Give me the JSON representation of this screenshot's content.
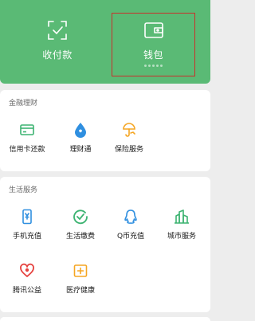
{
  "header": {
    "pay": {
      "label": "收付款",
      "icon": "qr-scan-check-icon"
    },
    "wallet": {
      "label": "钱包",
      "icon": "wallet-icon"
    }
  },
  "finance": {
    "title": "金融理财",
    "items": [
      {
        "label": "信用卡还款",
        "icon": "credit-card-icon",
        "color": "#3cb371"
      },
      {
        "label": "理财通",
        "icon": "water-drop-icon",
        "color": "#2f8fe0"
      },
      {
        "label": "保险服务",
        "icon": "umbrella-hand-icon",
        "color": "#f5a623"
      }
    ]
  },
  "life": {
    "title": "生活服务",
    "items": [
      {
        "label": "手机充值",
        "icon": "phone-yen-icon",
        "color": "#2f8fe0"
      },
      {
        "label": "生活缴费",
        "icon": "check-circle-icon",
        "color": "#3cb371"
      },
      {
        "label": "Q币充值",
        "icon": "qq-penguin-icon",
        "color": "#2f8fe0"
      },
      {
        "label": "城市服务",
        "icon": "city-buildings-icon",
        "color": "#3cb371"
      },
      {
        "label": "腾讯公益",
        "icon": "heart-icon",
        "color": "#e64340"
      },
      {
        "label": "医疗健康",
        "icon": "medical-plus-icon",
        "color": "#f5a623"
      }
    ]
  },
  "colors": {
    "header_green": "#5aba75",
    "highlight_red": "#c9302c"
  }
}
